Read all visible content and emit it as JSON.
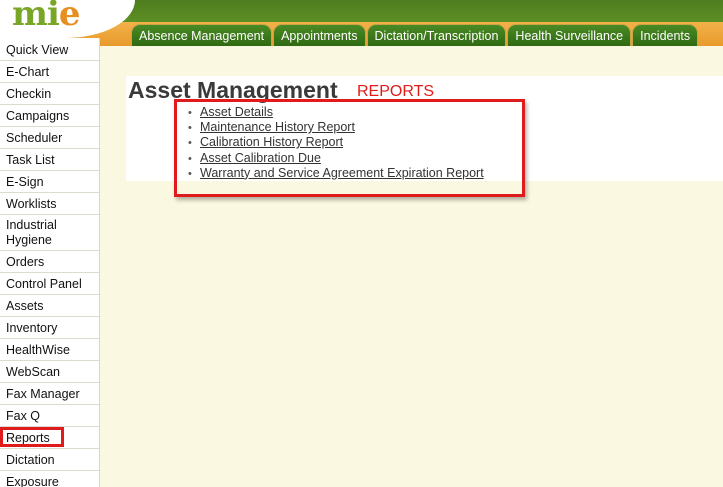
{
  "logo": {
    "text_main": "mi",
    "text_accent": "e"
  },
  "tabs": [
    {
      "label": "Absence Management"
    },
    {
      "label": "Appointments"
    },
    {
      "label": "Dictation/Transcription"
    },
    {
      "label": "Health Surveillance"
    },
    {
      "label": "Incidents"
    }
  ],
  "sidebar": {
    "items": [
      {
        "label": "Quick View"
      },
      {
        "label": "E-Chart"
      },
      {
        "label": "Checkin"
      },
      {
        "label": "Campaigns"
      },
      {
        "label": "Scheduler"
      },
      {
        "label": "Task List"
      },
      {
        "label": "E-Sign"
      },
      {
        "label": "Worklists"
      },
      {
        "label": "Industrial Hygiene"
      },
      {
        "label": "Orders"
      },
      {
        "label": "Control Panel"
      },
      {
        "label": "Assets"
      },
      {
        "label": "Inventory"
      },
      {
        "label": "HealthWise"
      },
      {
        "label": "WebScan"
      },
      {
        "label": "Fax Manager"
      },
      {
        "label": "Fax Q"
      },
      {
        "label": "Reports"
      },
      {
        "label": "Dictation"
      },
      {
        "label": "Exposure"
      }
    ],
    "highlighted_item": "Reports"
  },
  "main": {
    "title": "Asset Management",
    "subtitle": "REPORTS",
    "reports": [
      {
        "label": "Asset Details"
      },
      {
        "label": "Maintenance History Report"
      },
      {
        "label": "Calibration History Report"
      },
      {
        "label": "Asset Calibration Due"
      },
      {
        "label": "Warranty and Service Agreement Expiration Report"
      }
    ]
  },
  "colors": {
    "header_green": "#4e7d1f",
    "header_orange": "#e89a2c",
    "tab_green": "#2f6a12",
    "page_background": "#fbf8e1",
    "highlight_red": "#e01b1b",
    "subtitle_red": "#e01b1b"
  }
}
